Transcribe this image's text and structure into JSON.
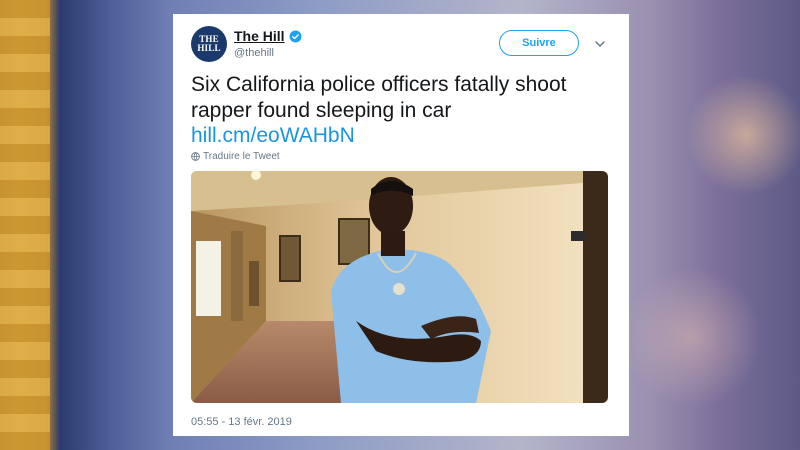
{
  "tweet": {
    "author_name": "The Hill",
    "handle": "@thehill",
    "avatar_text_line1": "THE",
    "avatar_text_line2": "HILL",
    "follow_label": "Suivre",
    "text": "Six California police officers fatally shoot rapper found sleeping in car",
    "link": "hill.cm/eoWAHbN",
    "translate_label": "Traduire le Tweet",
    "timestamp": "05:55 - 13 févr. 2019"
  },
  "icons": {
    "verified": "verified-badge-icon",
    "caret": "chevron-down-icon",
    "globe": "globe-icon"
  },
  "colors": {
    "accent": "#1da1f2",
    "link": "#1b95e0",
    "logo_bg": "#1b3a6b",
    "muted": "#657786"
  }
}
